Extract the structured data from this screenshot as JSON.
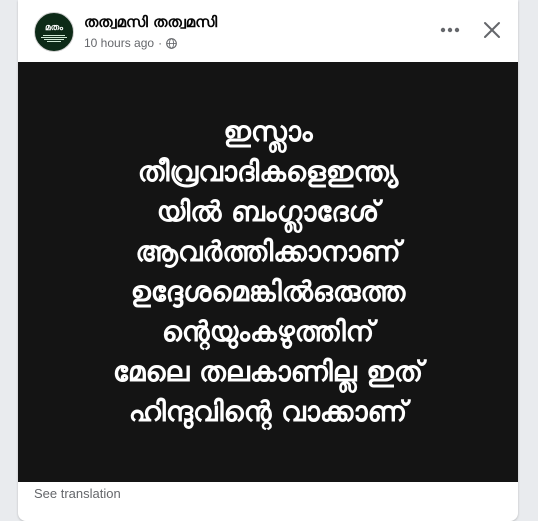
{
  "post": {
    "author": "തത്വമസി തത്വമസി",
    "timestamp": "10 hours ago",
    "separator": "·",
    "privacy_icon": "globe-icon",
    "avatar_logo": "മതം",
    "image_text": "ഇസ്ലാം\nതീവ്രവാദികളെഇന്ത്യ\nയിൽ ബംഗ്ലാദേശ്\nആവർത്തിക്കാനാണ്\nഉദ്ദേശമെങ്കിൽഒരുത്ത\nന്റെയുംകഴുത്തിന്\nമേലെ തലകാണില്ല ഇത്\nഹിന്ദുവിന്റെ വാക്കാണ്",
    "see_translation": "See translation"
  },
  "icons": {
    "more": "more-options-icon",
    "close": "close-icon"
  },
  "colors": {
    "card_bg": "#ffffff",
    "page_bg": "#e9ebee",
    "image_bg": "#141414",
    "secondary_text": "#65676b"
  }
}
